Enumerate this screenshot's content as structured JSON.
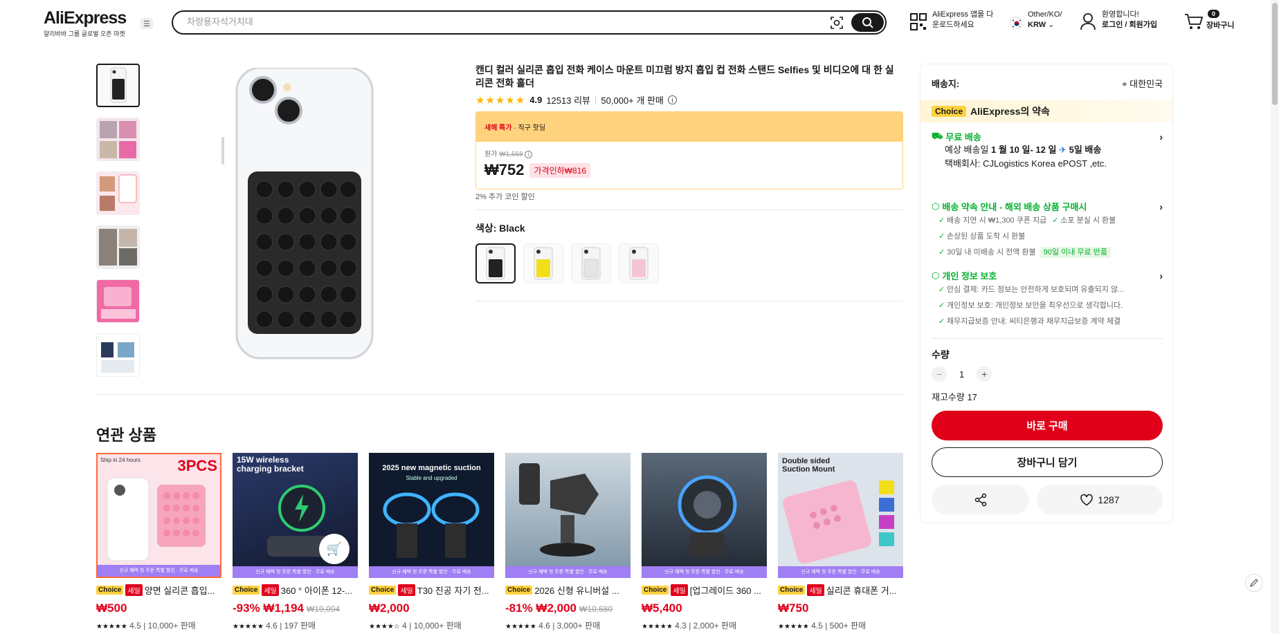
{
  "header": {
    "logo": "AliExpress",
    "logo_sub": "알리바바 그룹 글로벌 오픈 마켓",
    "search_placeholder": "차량용자석거치대",
    "app_line1": "AliExpress 앱을 다",
    "app_line2": "운로드하세요",
    "lang_line1": "Other/KO/",
    "lang_line2": "KRW",
    "welcome": "환영합니다!",
    "login": "로그인 / 회원가입",
    "cart_count": "0",
    "cart_label": "장바구니"
  },
  "product": {
    "title": "캔디 컬러 실리콘 흡입 전화 케이스 마운트 미끄럼 방지 흡입 컵 전화 스탠드 Selfies 및 비디오에 대 한 실리콘 전화 홀더",
    "rating": "4.9",
    "reviews": "12513 리뷰",
    "sold": "50,000+ 개 판매",
    "promo_label": "새해 특가",
    "promo_sub": " · 직구 핫딜",
    "orig_label": "원가",
    "orig_price": "₩1,568",
    "price": "₩752",
    "discount": "가격인하₩816",
    "coin_note": "2% 추가 코인 할인",
    "color_label": "색상: Black",
    "swatch_colors": [
      "#222222",
      "#f2df1a",
      "#e5e5e5",
      "#f4c6d3"
    ]
  },
  "panel": {
    "ship_to_label": "배송지:",
    "ship_to_value": "대한민국",
    "choice_badge": "Choice",
    "choice_promise": "AliExpress의 약속",
    "free_ship": "무료 배송",
    "est_prefix": "예상 배송일 ",
    "est_dates": "1 월 10 일- 12 일",
    "est_fast": "5일 배송",
    "carrier": "택배회사:  CJLogistics  Korea ePOST ,etc.",
    "guarantee_title": "배송 약속 안내 - 해외 배송 상품 구매시",
    "guarantee_items": [
      "배송 지연 시 ₩1,300 쿠폰 지급",
      "소포 분실 시 환불",
      "손상된 상품 도착 시 환불",
      "30일 내 미배송 시 전액 환불"
    ],
    "free_return_tag": "90일 이내 무료 반품",
    "privacy_title": "개인 정보 보호",
    "privacy_items": [
      "안심 결제: 카드 정보는 안전하게 보호되며 유출되지 않...",
      "개인정보 보호: 개인정보 보안을 최우선으로 생각합니다.",
      "채무지급보증 안내: 씨티은행과 채무지급보증 계약 체결"
    ],
    "qty_label": "수량",
    "qty_value": "1",
    "stock": "재고수량 17",
    "buy_now": "바로 구매",
    "add_cart": "장바구니 담기",
    "wish_count": "1287"
  },
  "related": {
    "title": "연관 상품",
    "strip_text": "신규 혜택 첫 주문 특별 할인 · 무료 배송",
    "tag_choice": "Choice",
    "tag_sale": "세일",
    "items": [
      {
        "title": "양면 실리콘 흡입...",
        "price": "₩500",
        "orig": "",
        "rating": "4.5",
        "sold": "10,000+ 판매",
        "overlay": "3PCS",
        "top": "Ship in 24 hours",
        "img_color": "#fbe4ea"
      },
      {
        "title": "360 ° 아이폰 12-...",
        "price": "-93% ₩1,194",
        "orig": "₩19,094",
        "rating": "4.6",
        "sold": "197 판매",
        "overlay": "15W wireless charging bracket",
        "top": "",
        "img_color": "#1f2a4a"
      },
      {
        "title": "T30 진공 자기 전...",
        "price": "₩2,000",
        "orig": "",
        "rating": "4",
        "sold": "10,000+ 판매",
        "overlay": "2025 new magnetic suction",
        "top": "Stable and upgraded",
        "img_color": "#0f1a2e"
      },
      {
        "title": "2026 신형 유니버설 ...",
        "price": "-81% ₩2,000",
        "orig": "₩10,680",
        "rating": "4.6",
        "sold": "3,000+ 판매",
        "overlay": "",
        "top": "",
        "img_color": "#8fa4b5"
      },
      {
        "title": "[업그레이드 360 ...",
        "price": "₩5,400",
        "orig": "",
        "rating": "4.3",
        "sold": "2,000+ 판매",
        "overlay": "",
        "top": "",
        "img_color": "#2b3440"
      },
      {
        "title": "실리콘 휴대폰 거...",
        "price": "₩750",
        "orig": "",
        "rating": "4.5",
        "sold": "500+ 판매",
        "overlay": "Double sided Suction Mount",
        "top": "",
        "img_color": "#dde3ea"
      }
    ]
  }
}
